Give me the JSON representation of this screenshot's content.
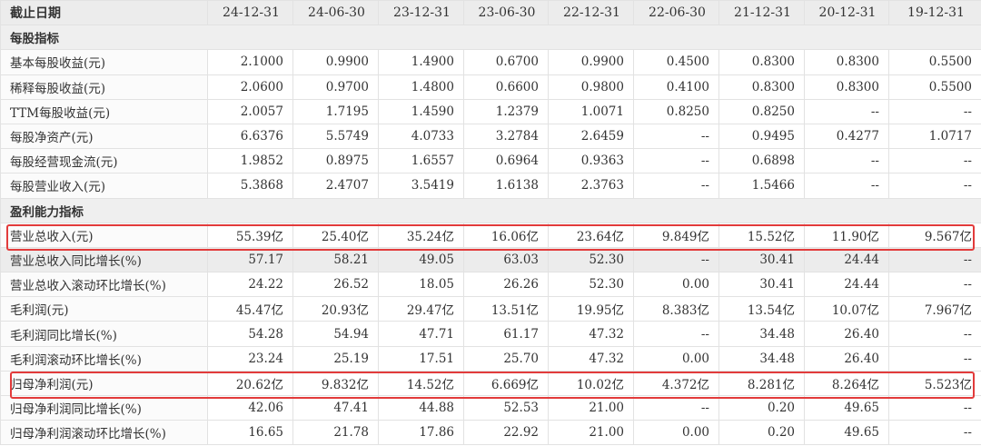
{
  "header": {
    "label": "截止日期",
    "dates": [
      "24-12-31",
      "24-06-30",
      "23-12-31",
      "23-06-30",
      "22-12-31",
      "22-06-30",
      "21-12-31",
      "20-12-31",
      "19-12-31"
    ]
  },
  "section1": {
    "title": "每股指标"
  },
  "rows1": [
    {
      "label": "基本每股收益(元)",
      "values": [
        "2.1000",
        "0.9900",
        "1.4900",
        "0.6700",
        "0.9900",
        "0.4500",
        "0.8300",
        "0.8300",
        "0.5500"
      ]
    },
    {
      "label": "稀释每股收益(元)",
      "values": [
        "2.0600",
        "0.9700",
        "1.4800",
        "0.6600",
        "0.9800",
        "0.4100",
        "0.8300",
        "0.8300",
        "0.5500"
      ]
    },
    {
      "label": "TTM每股收益(元)",
      "values": [
        "2.0057",
        "1.7195",
        "1.4590",
        "1.2379",
        "1.0071",
        "0.8250",
        "0.8250",
        "--",
        "--"
      ]
    },
    {
      "label": "每股净资产(元)",
      "values": [
        "6.6376",
        "5.5749",
        "4.0733",
        "3.2784",
        "2.6459",
        "--",
        "0.9495",
        "0.4277",
        "1.0717"
      ]
    },
    {
      "label": "每股经营现金流(元)",
      "values": [
        "1.9852",
        "0.8975",
        "1.6557",
        "0.6964",
        "0.9363",
        "--",
        "0.6898",
        "--",
        "--"
      ]
    },
    {
      "label": "每股营业收入(元)",
      "values": [
        "5.3868",
        "2.4707",
        "3.5419",
        "1.6138",
        "2.3763",
        "--",
        "1.5466",
        "--",
        "--"
      ]
    }
  ],
  "section2": {
    "title": "盈利能力指标"
  },
  "rows2": [
    {
      "label": "营业总收入(元)",
      "values": [
        "55.39亿",
        "25.40亿",
        "35.24亿",
        "16.06亿",
        "23.64亿",
        "9.849亿",
        "15.52亿",
        "11.90亿",
        "9.567亿"
      ],
      "highlight": true
    },
    {
      "label": "营业总收入同比增长(%)",
      "values": [
        "57.17",
        "58.21",
        "49.05",
        "63.03",
        "52.30",
        "--",
        "30.41",
        "24.44",
        "--"
      ],
      "shaded": true
    },
    {
      "label": "营业总收入滚动环比增长(%)",
      "values": [
        "24.22",
        "26.52",
        "18.05",
        "26.26",
        "52.30",
        "0.00",
        "30.41",
        "24.44",
        "--"
      ]
    },
    {
      "label": "毛利润(元)",
      "values": [
        "45.47亿",
        "20.93亿",
        "29.47亿",
        "13.51亿",
        "19.95亿",
        "8.383亿",
        "13.54亿",
        "10.07亿",
        "7.967亿"
      ]
    },
    {
      "label": "毛利润同比增长(%)",
      "values": [
        "54.28",
        "54.94",
        "47.71",
        "61.17",
        "47.32",
        "--",
        "34.48",
        "26.40",
        "--"
      ]
    },
    {
      "label": "毛利润滚动环比增长(%)",
      "values": [
        "23.24",
        "25.19",
        "17.51",
        "25.70",
        "47.32",
        "0.00",
        "34.48",
        "26.40",
        "--"
      ]
    },
    {
      "label": "归母净利润(元)",
      "values": [
        "20.62亿",
        "9.832亿",
        "14.52亿",
        "6.669亿",
        "10.02亿",
        "4.372亿",
        "8.281亿",
        "8.264亿",
        "5.523亿"
      ],
      "highlight": true
    },
    {
      "label": "归母净利润同比增长(%)",
      "values": [
        "42.06",
        "47.41",
        "44.88",
        "52.53",
        "21.00",
        "--",
        "0.20",
        "49.65",
        "--"
      ]
    },
    {
      "label": "归母净利润滚动环比增长(%)",
      "values": [
        "16.65",
        "21.78",
        "17.86",
        "22.92",
        "21.00",
        "0.00",
        "0.20",
        "49.65",
        "--"
      ]
    }
  ]
}
